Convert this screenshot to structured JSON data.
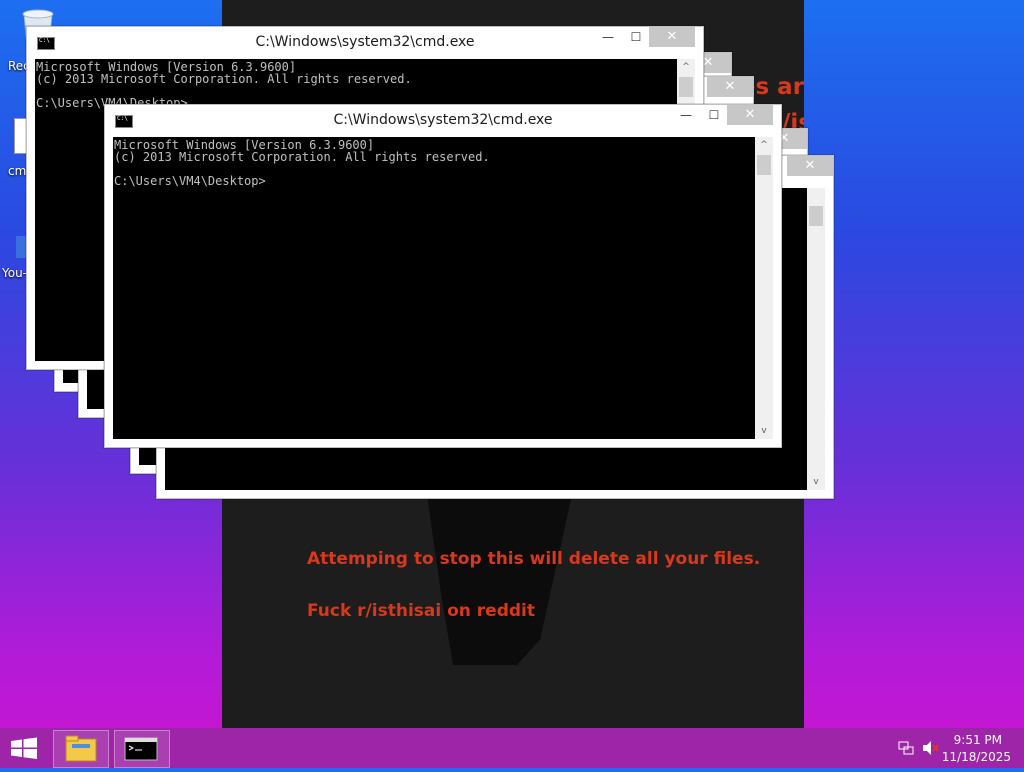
{
  "desktop": {
    "icons": [
      {
        "label": "Rec",
        "icon": "recycle-bin-icon"
      },
      {
        "label": "cm",
        "icon": "file-icon"
      },
      {
        "label": "You-",
        "icon": "app-icon"
      }
    ]
  },
  "background_window": {
    "text_line1": "les are GONE",
    "text_line2": "/isthisAI",
    "warning": "Attemping to stop this will delete all your files.",
    "message": "Fuck r/isthisai on reddit",
    "text_color": "#d8381c"
  },
  "cmd": {
    "title": "C:\\Windows\\system32\\cmd.exe",
    "line1": "Microsoft Windows [Version 6.3.9600]",
    "line2": "(c) 2013 Microsoft Corporation. All rights reserved.",
    "prompt": "C:\\Users\\VM4\\Desktop>",
    "min_label": "—",
    "max_label": "☐",
    "close_label": "✕"
  },
  "taskbar": {
    "time": "9:51 PM",
    "date": "11/18/2025",
    "apps": [
      {
        "name": "File Explorer",
        "icon": "folder-icon"
      },
      {
        "name": "Command Prompt",
        "icon": "cmd-icon"
      }
    ]
  }
}
